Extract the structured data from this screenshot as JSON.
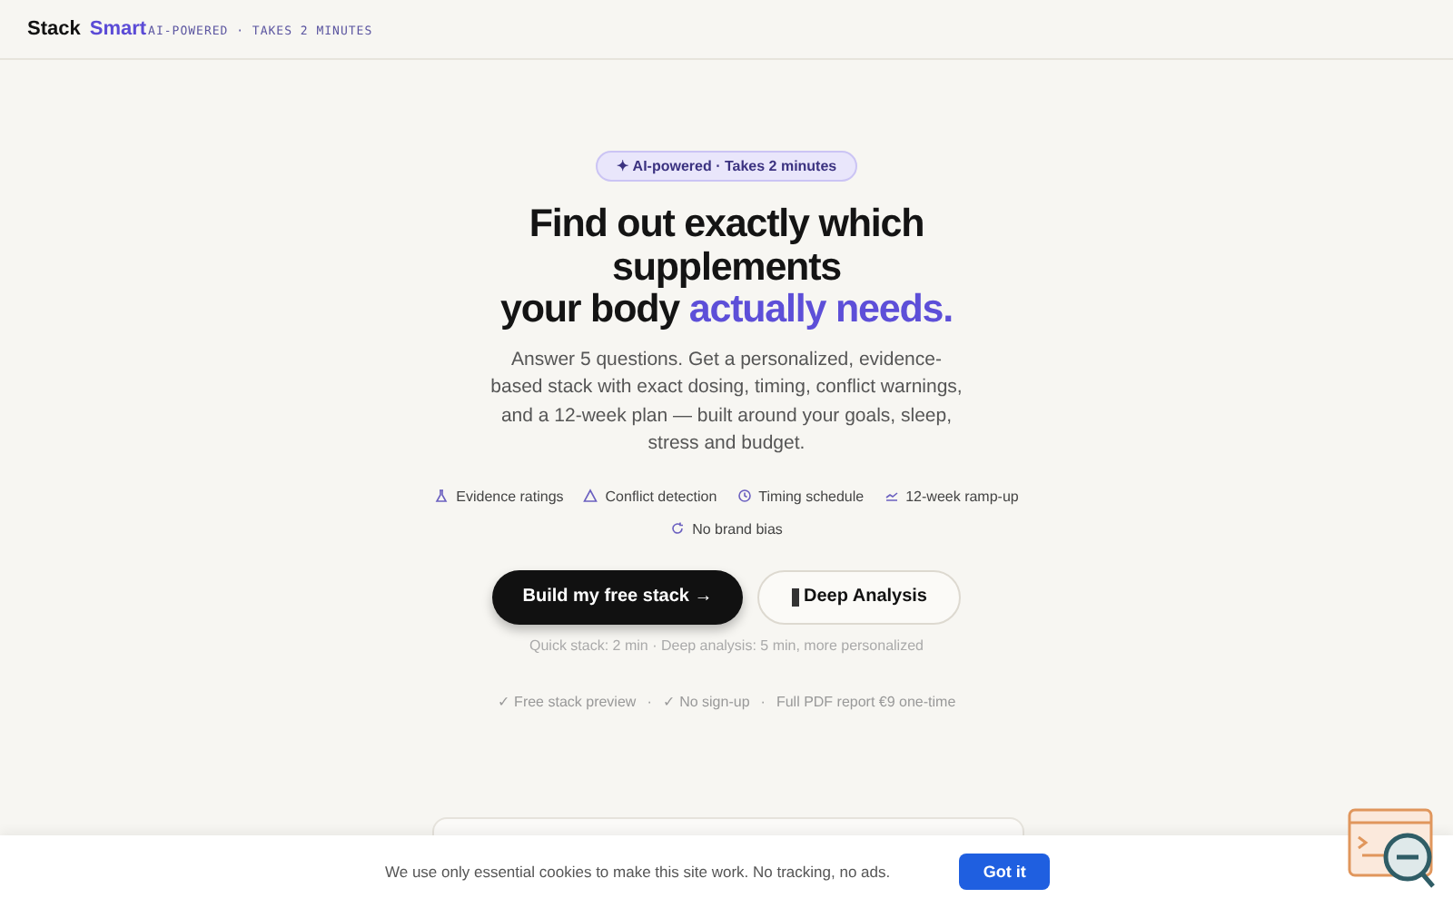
{
  "header": {
    "brand": "Stack",
    "brand_accent": "Smart",
    "tagline": "AI-POWERED · TAKES 2 MINUTES"
  },
  "badge": {
    "icon": "✦",
    "text": "AI-powered · Takes 2 minutes"
  },
  "headline": {
    "lines": [
      "Find out exactly which",
      "supplements",
      "your body"
    ],
    "accent": "actually needs."
  },
  "intro": "Answer 5 questions. Get a personalized, evidence-based stack with exact dosing, timing, conflict warnings, and a 12-week plan — built around your goals, sleep, stress and budget.",
  "features": [
    {
      "kind": "flask",
      "label": "Evidence ratings"
    },
    {
      "kind": "warning",
      "label": "Conflict detection"
    },
    {
      "kind": "clock",
      "label": "Timing schedule"
    },
    {
      "kind": "trend",
      "label": "12-week ramp-up"
    },
    {
      "kind": "refresh",
      "label": "No brand bias"
    }
  ],
  "primary_button": "Build my free stack →",
  "secondary_button": "Deep Analysis",
  "note": "Quick stack: 2 min · Deep analysis: 5 min, more personalized",
  "checks": [
    "✓ Free stack preview",
    "·",
    "✓ No sign-up",
    "·",
    "Full PDF report €9 one-time"
  ],
  "cookie": {
    "text": "We use only essential cookies to make this site work. No tracking, no ads.",
    "button": "Got it"
  }
}
